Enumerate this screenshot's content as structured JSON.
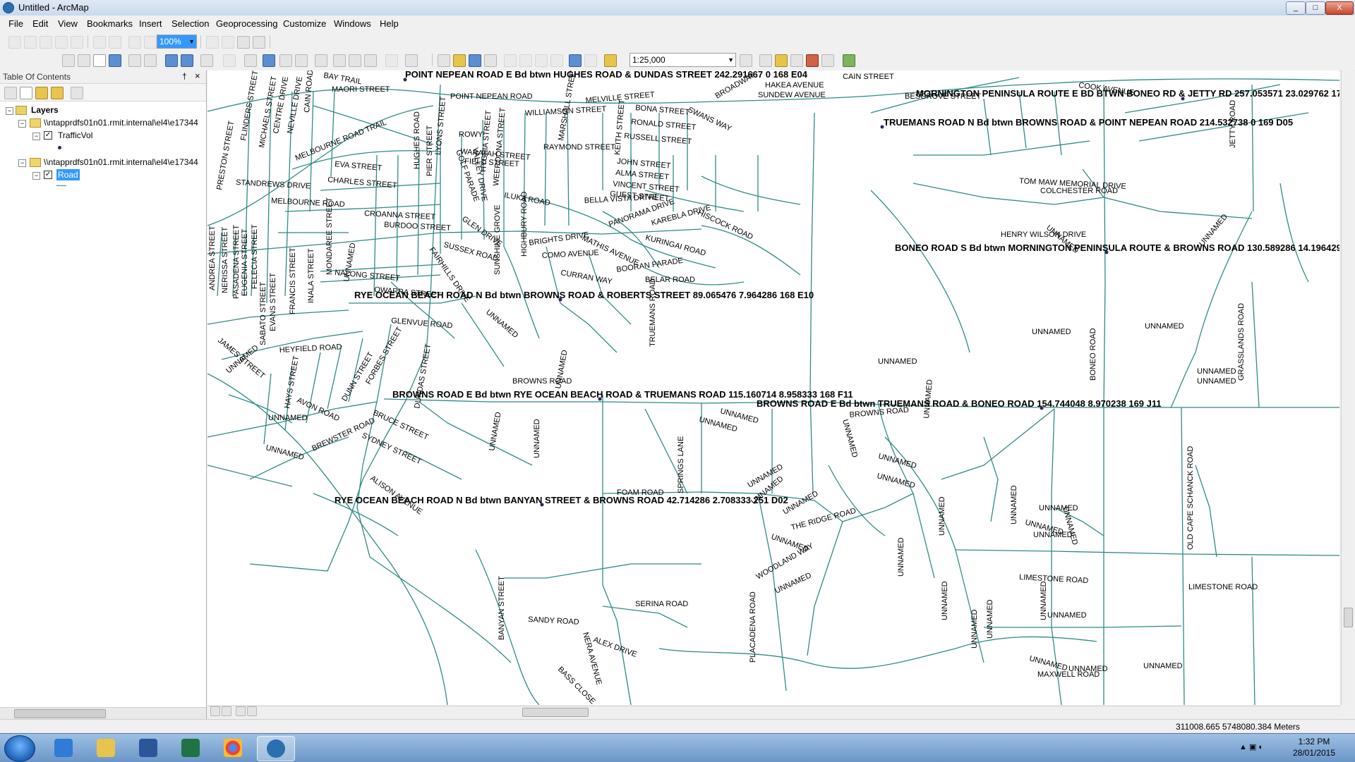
{
  "window": {
    "title": "Untitled - ArcMap",
    "min": "_",
    "max": "□",
    "close": "X"
  },
  "menu": [
    "File",
    "Edit",
    "View",
    "Bookmarks",
    "Insert",
    "Selection",
    "Geoprocessing",
    "Customize",
    "Windows",
    "Help"
  ],
  "toolbar": {
    "zoom_percent": "100%",
    "scale": "1:25,000"
  },
  "toc": {
    "title": "Table Of Contents",
    "pin": "†",
    "close": "×",
    "layers_label": "Layers",
    "group1_path": "\\\\ntapprdfs01n01.rmit.internal\\el4\\e17344",
    "layer1": "TrafficVol",
    "group2_path": "\\\\ntapprdfs01n01.rmit.internal\\el4\\e17344",
    "layer2": "Road"
  },
  "map": {
    "annotations": [
      "POINT NEPEAN ROAD E Bd btwn HUGHES ROAD & DUNDAS STREET 242.291667 0 168 E04",
      "MORNINGTON PENINSULA ROUTE E BD BTWN BONEO RD & JETTY RD 257.053571 23.029762 170 C05",
      "TRUEMANS ROAD N Bd btwn BROWNS ROAD & POINT NEPEAN ROAD 214.532738 0 169 D05",
      "BONEO ROAD S Bd btwn MORNINGTON PENINSULA ROUTE & BROWNS ROAD 130.589286 14.196429 170 A09",
      "RYE OCEAN BEACH ROAD N Bd btwn BROWNS ROAD & ROBERTS STREET 89.065476 7.964286 168 E10",
      "BROWNS ROAD E Bd btwn RYE OCEAN BEACH ROAD & TRUEMANS ROAD 115.160714 8.958333 168 F11",
      "BROWNS ROAD E Bd btwn TRUEMANS ROAD & BONEO ROAD 154.744048 8.970238 169 J11",
      "RYE OCEAN BEACH ROAD N Bd btwn BANYAN STREET & BROWNS ROAD 42.714286 2.708333 251 D02"
    ],
    "labels": {
      "bay_trail": "BAY TRAIL",
      "maori_street": "MAORI STREET",
      "point_nepean_road": "POINT NEPEAN ROAD",
      "melville_street": "MELVILLE STREET",
      "williamson_street": "WILLIAMSON STREET",
      "bona_street": "BONA STREET",
      "ronald_street": "RONALD STREET",
      "russell_street": "RUSSELL STREET",
      "swans_way": "SWANS WAY",
      "broadway": "BROADWAY",
      "hakea_avenue": "HAKEA AVENUE",
      "sundew_avenue": "SUNDEW AVENUE",
      "cain_street": "CAIN STREET",
      "besgrove_street": "BESGROVE STREET",
      "cook_avenue": "COOK AVENUE",
      "rowy": "ROWY",
      "waratah_street": "WARATAH STREET",
      "raymond_street": "RAYMOND STREET",
      "field_street": "FIELD STREET",
      "john_street": "JOHN STREET",
      "alma_street": "ALMA STREET",
      "vincent_street": "VINCENT STREET",
      "guest_street": "GUEST STREET",
      "tom_maw": "TOM MAW MEMORIAL DRIVE",
      "colchester_road": "COLCHESTER ROAD",
      "henry_wilson": "HENRY WILSON DRIVE",
      "jetty_road": "JETTY ROAD",
      "melbourne_road_trail": "MELBOURNE ROAD TRAIL",
      "eva_street": "EVA STREET",
      "charles_street": "CHARLES STREET",
      "standrews_drive": "STANDREWS DRIVE",
      "melbourne_road": "MELBOURNE ROAD",
      "croanna_street": "CROANNA STREET",
      "burdoo_street": "BURDOO STREET",
      "glen_drive": "GLEN DRIVE",
      "iluka_road": "ILUKA ROAD",
      "bella_vista_drive": "BELLA VISTA DRIVE",
      "panorama_drive": "PANORAMA DRIVE",
      "karebla_drive": "KAREBLA DRIVE",
      "hiscock_road": "HISCOCK ROAD",
      "brights_drive": "BRIGHTS DRIVE",
      "como_avenue": "COMO AVENUE",
      "mathis_avenue": "MATHIS AVENUE",
      "kuringai_road": "KURINGAI ROAD",
      "curran_way": "CURRAN WAY",
      "booran_parade": "BOORAN PARADE",
      "belar_road": "BELAR ROAD",
      "sussex_road": "SUSSEX ROAD",
      "nalong_street": "NALONG STREET",
      "owarra_street": "OWARRA STREET",
      "glenvue_road": "GLENVUE ROAD",
      "heyfield_road": "HEYFIELD ROAD",
      "james_street": "JAMES STREET",
      "browns_road": "BROWNS ROAD",
      "truemans_road": "TRUEMANS ROAD",
      "boneo_road": "BONEO ROAD",
      "unnamed": "UNNAMED",
      "grasslands_road": "GRASSLANDS ROAD",
      "old_cape_schanck_road": "OLD CAPE SCHANCK ROAD",
      "springs_lane": "SPRINGS LANE",
      "foam_road": "FOAM ROAD",
      "the_ridge_road": "THE RIDGE ROAD",
      "woodland_way": "WOODLAND WAY",
      "limestone_road": "LIMESTONE ROAD",
      "serina_road": "SERINA ROAD",
      "sandy_road": "SANDY ROAD",
      "banyan_street": "BANYAN STREET",
      "alex_drive": "ALEX DRIVE",
      "nera_avenue": "NERA AVENUE",
      "bass_close": "BASS CLOSE",
      "placadena_road": "PLACADENA ROAD",
      "maxwell_road": "MAXWELL ROAD",
      "alison_avenue": "ALISON AVENUE",
      "sydney_street": "SYDNEY STREET",
      "bruce_street": "BRUCE STREET",
      "brewster_road": "BREWSTER ROAD",
      "avon_road": "AVON ROAD",
      "hays_street": "HAYS STREET",
      "forbes_street": "FORBES STREET",
      "dunn_street": "DUNN STREET",
      "dundas_street": "DUNDAS STREET",
      "fairhills_drive": "FAIRHILLS DRIVE",
      "sunshine_grove": "SUNSHINE GROVE",
      "highbury_road": "HIGHBURY ROAD",
      "marshall_street": "MARSHALL STREET",
      "keith_street": "KEITH STREET",
      "preston_street": "PRESTON STREET",
      "andrea_street": "ANDREA STREET",
      "nerissa_street": "NERISSA STREET",
      "pasadena_street": "PASADENA STREET",
      "eugenia_street": "EUGENIA STREET",
      "felecia_street": "FELECIA STREET",
      "sabato_street": "SABATO STREET",
      "evans_street": "EVANS STREET",
      "francis_street": "FRANCIS STREET",
      "inala_street": "INALA STREET",
      "mondaree_street": "MONDAREE STREET",
      "flinders_street": "FLINDERS STREET",
      "michaels_street": "MICHAELS STREET",
      "centre_drive": "CENTRE DRIVE",
      "neville_drive": "NEVILLE DRIVE",
      "cain_road": "CAIN ROAD",
      "golf_parade": "GOLF PARADE",
      "valley_drive": "VALLEY DRIVE",
      "hygeia_street": "HYGEIA STREET",
      "weeroona_street": "WEEROONA STREET",
      "lyons_street": "LYONS STREET",
      "pier_street": "PIER STREET",
      "hughes_road": "HUGHES ROAD"
    }
  },
  "status": {
    "coords": "311008.665  5748080.384 Meters"
  },
  "taskbar": {
    "time": "1:32 PM",
    "date": "28/01/2015"
  },
  "colors": {
    "road": "#2e8b88",
    "point": "#3a1f5c",
    "selection": "#3399ff"
  }
}
